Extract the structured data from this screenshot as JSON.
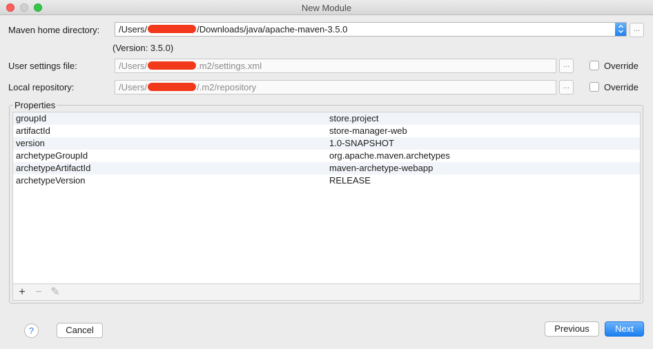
{
  "window": {
    "title": "New Module"
  },
  "maven_home": {
    "label": "Maven home directory:",
    "value_prefix": "/Users/",
    "value_suffix": "/Downloads/java/apache-maven-3.5.0",
    "version_text": "(Version: 3.5.0)",
    "browse_label": "..."
  },
  "user_settings": {
    "label": "User settings file:",
    "value_prefix": "/Users/",
    "value_suffix": ".m2/settings.xml",
    "browse_label": "...",
    "override_label": "Override",
    "override_checked": false
  },
  "local_repository": {
    "label": "Local repository:",
    "value_prefix": "/Users/",
    "value_suffix": "/.m2/repository",
    "browse_label": "...",
    "override_label": "Override",
    "override_checked": false
  },
  "properties": {
    "title": "Properties",
    "rows": [
      {
        "key": "groupId",
        "value": "store.project"
      },
      {
        "key": "artifactId",
        "value": "store-manager-web"
      },
      {
        "key": "version",
        "value": "1.0-SNAPSHOT"
      },
      {
        "key": "archetypeGroupId",
        "value": "org.apache.maven.archetypes"
      },
      {
        "key": "archetypeArtifactId",
        "value": "maven-archetype-webapp"
      },
      {
        "key": "archetypeVersion",
        "value": "RELEASE"
      }
    ],
    "toolbar": {
      "add": "+",
      "remove": "−",
      "edit": "✎"
    }
  },
  "footer": {
    "help_label": "?",
    "cancel_label": "Cancel",
    "previous_label": "Previous",
    "next_label": "Next"
  },
  "colors": {
    "accent": "#1a7ef0",
    "redaction": "#f2391c"
  }
}
